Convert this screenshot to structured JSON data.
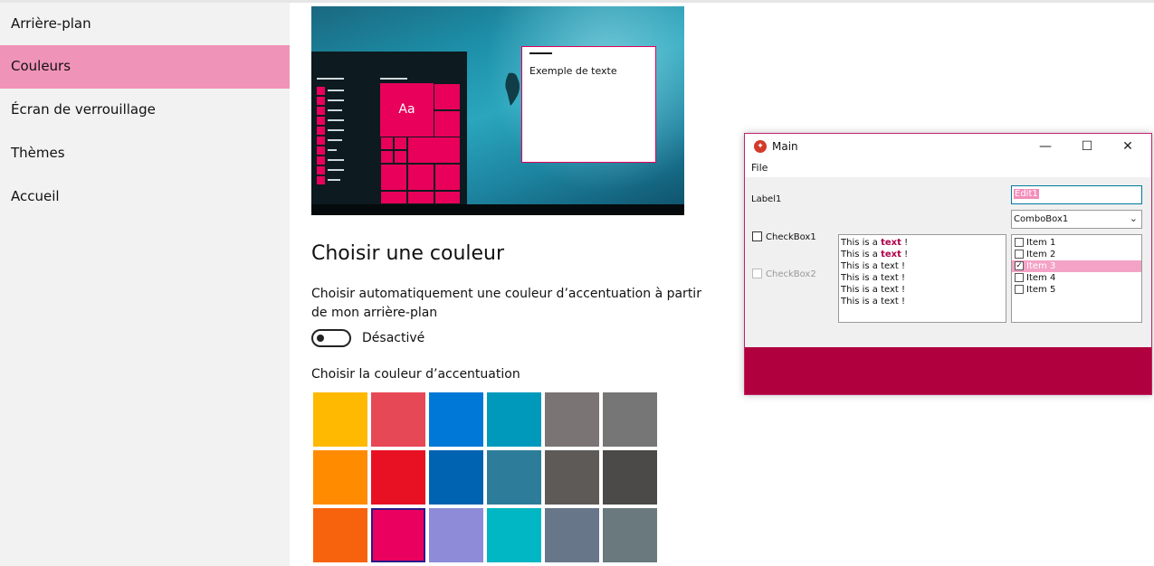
{
  "sidebar": {
    "items": [
      {
        "label": "Arrière-plan",
        "active": false
      },
      {
        "label": "Couleurs",
        "active": true
      },
      {
        "label": "Écran de verrouillage",
        "active": false
      },
      {
        "label": "Thèmes",
        "active": false
      },
      {
        "label": "Accueil",
        "active": false
      }
    ]
  },
  "preview": {
    "tile_text": "Aa",
    "sample_text": "Exemple de texte"
  },
  "main": {
    "heading": "Choisir une couleur",
    "auto_accent_description": "Choisir automatiquement une couleur d’accentuation à partir de mon arrière-plan",
    "toggle_state_label": "Désactivé",
    "accent_label": "Choisir la couleur d’accentuation",
    "swatches": [
      [
        "#ffb900",
        "#e74856",
        "#0078d7",
        "#0099bc",
        "#7a7574",
        "#767676"
      ],
      [
        "#ff8c00",
        "#e81123",
        "#0063b1",
        "#2d7d9a",
        "#5d5a58",
        "#4c4a48"
      ],
      [
        "#f7630c",
        "#ea005e",
        "#8e8cd8",
        "#00b7c3",
        "#68768a",
        "#69797e"
      ]
    ],
    "selected_swatch": "#ea005e"
  },
  "window": {
    "title": "Main",
    "app_icon": "delphi-app-icon",
    "controls": {
      "minimize": "—",
      "maximize": "☐",
      "close": "✕"
    },
    "menu_file": "File",
    "label1": "Label1",
    "edit1": "Edit1",
    "combobox1": "ComboBox1",
    "checkbox1": "CheckBox1",
    "checkbox2": "CheckBox2",
    "memo": {
      "prefix": "This is a ",
      "bold": "text",
      "suffix": " !",
      "plain": "This is a text !"
    },
    "checklist": [
      {
        "label": "Item 1",
        "checked": false,
        "selected": false
      },
      {
        "label": "Item 2",
        "checked": false,
        "selected": false
      },
      {
        "label": "Item 3",
        "checked": true,
        "selected": true
      },
      {
        "label": "Item 4",
        "checked": false,
        "selected": false
      },
      {
        "label": "Item 5",
        "checked": false,
        "selected": false
      }
    ],
    "accent_color": "#b0003d"
  }
}
